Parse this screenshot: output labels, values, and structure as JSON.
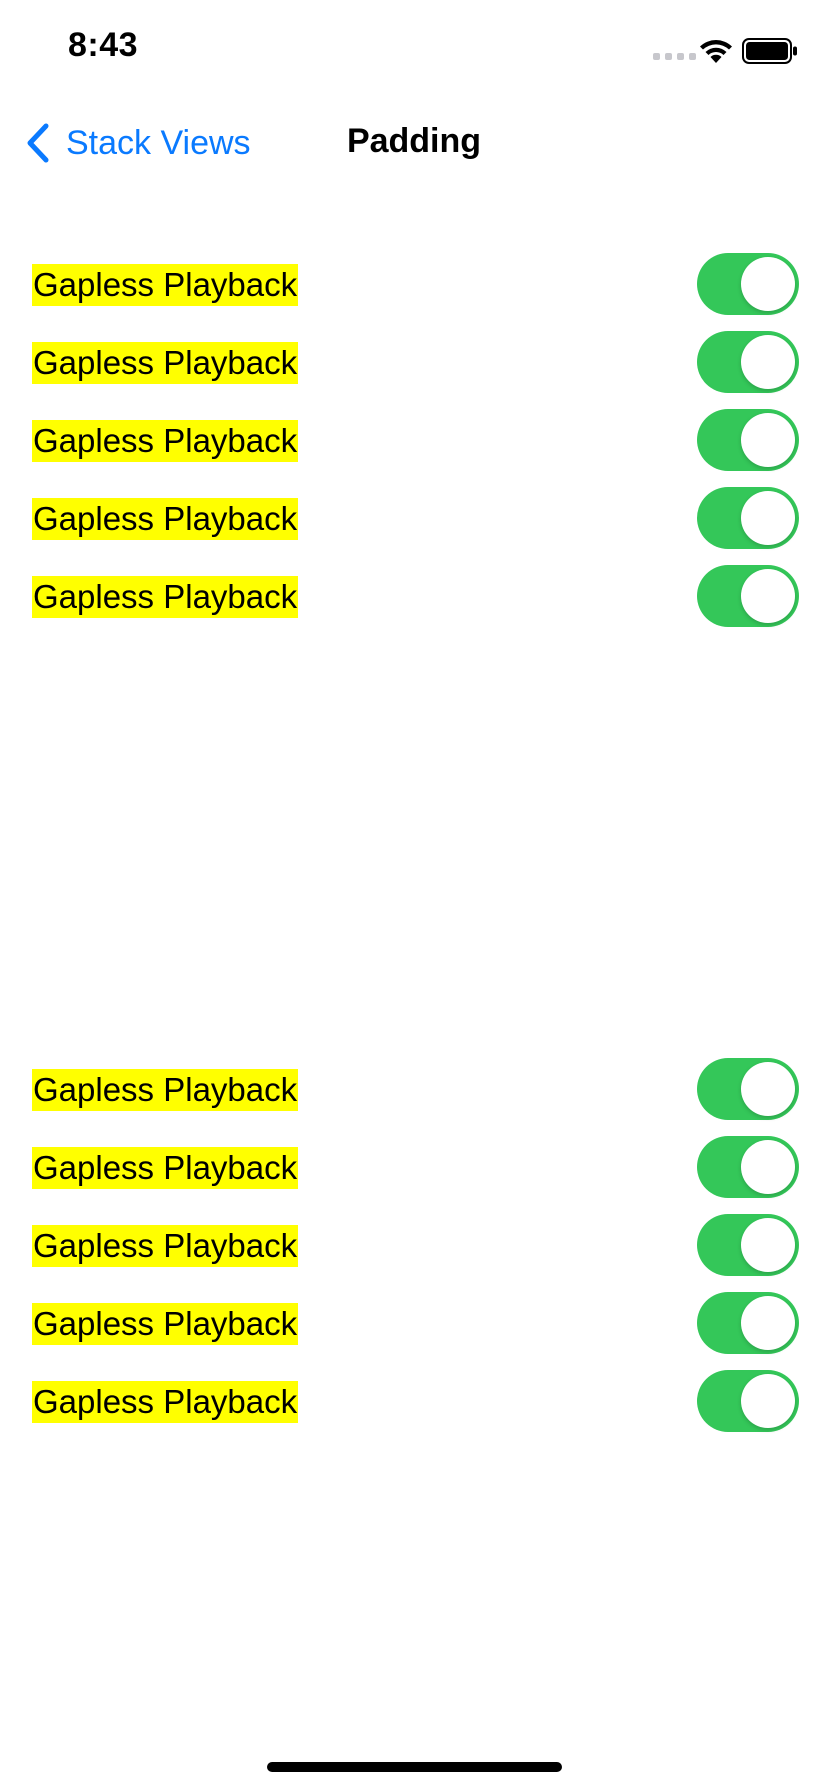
{
  "status_bar": {
    "time": "8:43"
  },
  "nav": {
    "back_label": "Stack Views",
    "title": "Padding"
  },
  "colors": {
    "accent": "#0a7aff",
    "toggle_on": "#34c759",
    "label_highlight": "#ffff00"
  },
  "section1": {
    "rows": [
      {
        "label": "Gapless Playback",
        "on": true
      },
      {
        "label": "Gapless Playback",
        "on": true
      },
      {
        "label": "Gapless Playback",
        "on": true
      },
      {
        "label": "Gapless Playback",
        "on": true
      },
      {
        "label": "Gapless Playback",
        "on": true
      }
    ]
  },
  "section2": {
    "rows": [
      {
        "label": "Gapless Playback",
        "on": true
      },
      {
        "label": "Gapless Playback",
        "on": true
      },
      {
        "label": "Gapless Playback",
        "on": true
      },
      {
        "label": "Gapless Playback",
        "on": true
      },
      {
        "label": "Gapless Playback",
        "on": true
      }
    ]
  }
}
